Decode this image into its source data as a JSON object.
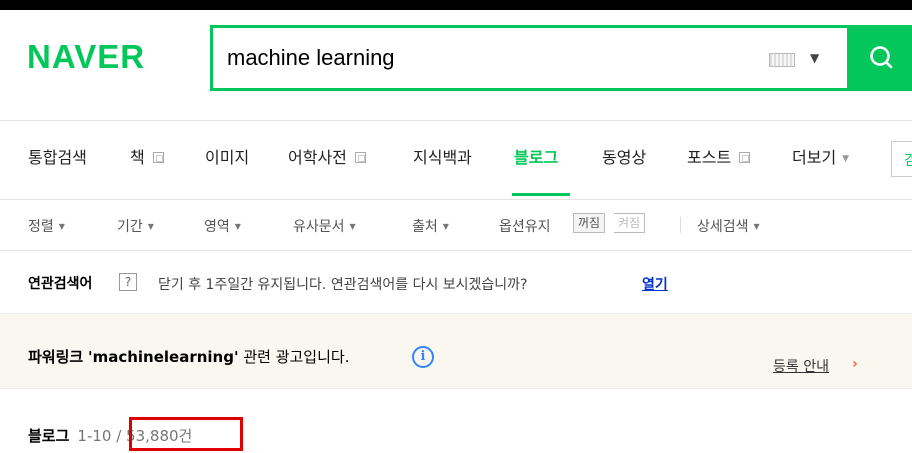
{
  "header": {
    "logo": "NAVER",
    "search_value": "machine learning",
    "colors": {
      "brand": "#03c75a",
      "link": "#0033cc",
      "highlight": "#e00000",
      "powerlink_bg": "#faf7f0"
    },
    "icons": [
      "keyboard-icon",
      "chevron-down-icon",
      "search-icon"
    ]
  },
  "tabs": [
    {
      "label": "통합검색"
    },
    {
      "label": "책"
    },
    {
      "label": "이미지"
    },
    {
      "label": "어학사전"
    },
    {
      "label": "지식백과"
    },
    {
      "label": "블로그",
      "active": true
    },
    {
      "label": "동영상"
    },
    {
      "label": "포스트"
    },
    {
      "label": "더보기"
    }
  ],
  "tabs_extra": "검",
  "filters": {
    "sort": "정렬",
    "period": "기간",
    "area": "영역",
    "similar": "유사문서",
    "source": "출처",
    "option_keep": "옵션유지",
    "toggle_off": "꺼짐",
    "toggle_on": "켜짐",
    "detail": "상세검색"
  },
  "related": {
    "title": "연관검색어",
    "help": "?",
    "message": "닫기 후 1주일간 유지됩니다. 연관검색어를 다시 보시겠습니까?",
    "open_link": "열기"
  },
  "powerlink": {
    "title": "파워링크",
    "keyword": "'machinelearning'",
    "suffix": "관련 광고입니다.",
    "info": "i",
    "register": "등록 안내",
    "arrow": "›"
  },
  "blog_count": {
    "label": "블로그",
    "range": "1-10 / 53,880건"
  }
}
